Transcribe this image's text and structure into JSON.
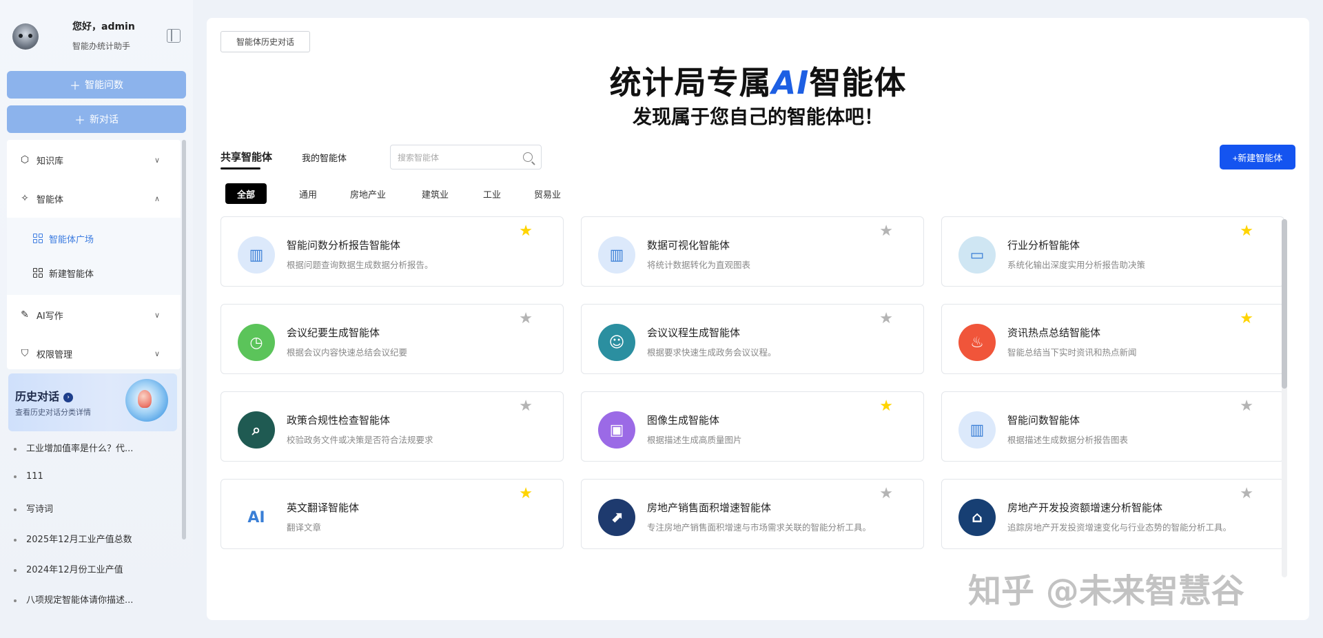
{
  "user": {
    "greeting": "您好，admin",
    "role": "智能办统计助手"
  },
  "sidebar": {
    "ask_button": "智能问数",
    "new_chat_button": "新对话",
    "menu": [
      {
        "label": "知识库",
        "icon": "cube-icon",
        "expanded": false
      },
      {
        "label": "智能体",
        "icon": "sparkle-icon",
        "expanded": true
      },
      {
        "label": "AI写作",
        "icon": "pen-icon",
        "expanded": false
      },
      {
        "label": "权限管理",
        "icon": "shield-icon",
        "expanded": false
      }
    ],
    "submenu": [
      {
        "label": "智能体广场",
        "active": true
      },
      {
        "label": "新建智能体",
        "active": false
      }
    ],
    "history_card": {
      "title": "历史对话",
      "subtitle": "查看历史对话分类详情"
    },
    "history": [
      "工业增加值率是什么？代...",
      "111",
      "写诗词",
      "2025年12月工业产值总数",
      "2024年12月份工业产值",
      "八项规定智能体请你描述..."
    ]
  },
  "main": {
    "history_button": "智能体历史对话",
    "title_pre": "统计局专属",
    "title_ai": "AI",
    "title_post": "智能体",
    "subtitle": "发现属于您自己的智能体吧！",
    "tabs": [
      "共享智能体",
      "我的智能体"
    ],
    "search_placeholder": "搜索智能体",
    "new_agent_button": "+新建智能体",
    "categories": [
      "全部",
      "通用",
      "房地产业",
      "建筑业",
      "工业",
      "贸易业"
    ]
  },
  "agents": [
    {
      "name": "智能问数分析报告智能体",
      "desc": "根据问题查询数据生成数据分析报告。",
      "starred": true,
      "icon": "chart-report-icon",
      "color": "#dce9fb"
    },
    {
      "name": "数据可视化智能体",
      "desc": "将统计数据转化为直观图表",
      "starred": false,
      "icon": "chart-visual-icon",
      "color": "#dce9fb"
    },
    {
      "name": "行业分析智能体",
      "desc": "系统化输出深度实用分析报告助决策",
      "starred": true,
      "icon": "monitor-icon",
      "color": "#cfe6f3"
    },
    {
      "name": "会议纪要生成智能体",
      "desc": "根据会议内容快速总结会议纪要",
      "starred": false,
      "icon": "clock-check-icon",
      "color": "#5bc45a"
    },
    {
      "name": "会议议程生成智能体",
      "desc": "根据要求快速生成政务会议议程。",
      "starred": false,
      "icon": "meeting-icon",
      "color": "#2b8fa0"
    },
    {
      "name": "资讯热点总结智能体",
      "desc": "智能总结当下实时资讯和热点新闻",
      "starred": true,
      "icon": "fire-icon",
      "color": "#f0553a"
    },
    {
      "name": "政策合规性检查智能体",
      "desc": "校验政务文件或决策是否符合法规要求",
      "starred": false,
      "icon": "magnifier-doc-icon",
      "color": "#1f5a52"
    },
    {
      "name": "图像生成智能体",
      "desc": "根据描述生成高质量图片",
      "starred": true,
      "icon": "image-icon",
      "color": "#9b6ae6"
    },
    {
      "name": "智能问数智能体",
      "desc": "根据描述生成数据分析报告图表",
      "starred": false,
      "icon": "chart-ask-icon",
      "color": "#dce9fb"
    },
    {
      "name": "英文翻译智能体",
      "desc": "翻译文章",
      "starred": true,
      "icon": "ai-text-icon",
      "color": "#ffffff"
    },
    {
      "name": "房地产销售面积增速智能体",
      "desc": "专注房地产销售面积增速与市场需求关联的智能分析工具。",
      "starred": false,
      "icon": "building-growth-icon",
      "color": "#1e3a6e"
    },
    {
      "name": "房地产开发投资额增速分析智能体",
      "desc": "追踪房地产开发投资增速变化与行业态势的智能分析工具。",
      "starred": false,
      "icon": "house-chart-icon",
      "color": "#173f73"
    }
  ],
  "watermark": "知乎 @未来智慧谷"
}
